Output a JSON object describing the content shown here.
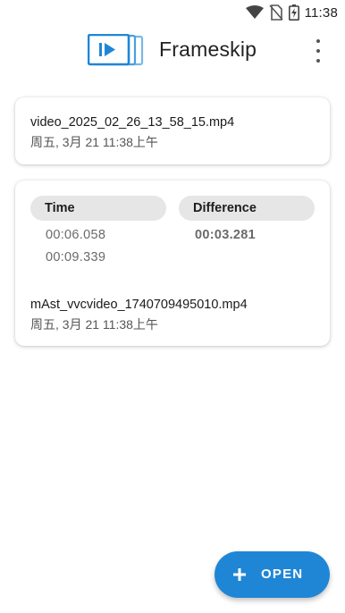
{
  "status_bar": {
    "time": "11:38"
  },
  "app_bar": {
    "title": "Frameskip"
  },
  "files": [
    {
      "name": "video_2025_02_26_13_58_15.mp4",
      "date": "周五, 3月 21 11:38上午"
    }
  ],
  "comparison": {
    "headers": {
      "time": "Time",
      "difference": "Difference"
    },
    "times": [
      "00:06.058",
      "00:09.339"
    ],
    "difference": "00:03.281",
    "file": {
      "name": "mAst_vvcvideo_1740709495010.mp4",
      "date": "周五, 3月 21 11:38上午"
    }
  },
  "fab": {
    "label": "OPEN",
    "color": "#1f86d6"
  },
  "colors": {
    "accent": "#1f86d6",
    "pill_bg": "#e6e6e6"
  }
}
